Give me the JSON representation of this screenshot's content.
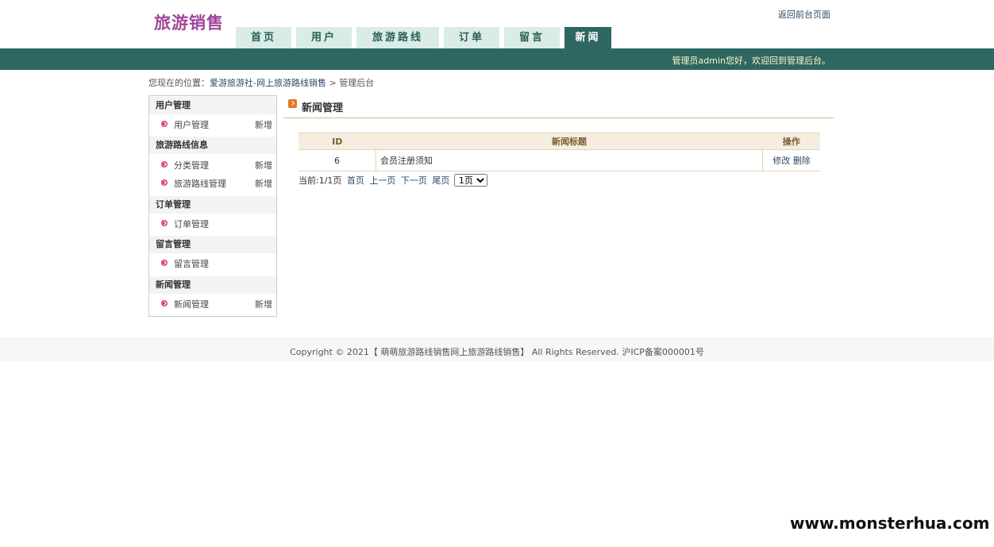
{
  "header": {
    "logo": "旅游销售",
    "back_link": "返回前台页面",
    "nav": [
      {
        "label": "首页",
        "active": false
      },
      {
        "label": "用户",
        "active": false
      },
      {
        "label": "旅游路线",
        "active": false
      },
      {
        "label": "订单",
        "active": false
      },
      {
        "label": "留言",
        "active": false
      },
      {
        "label": "新闻",
        "active": true
      }
    ],
    "welcome": "管理员admin您好，欢迎回到管理后台。"
  },
  "breadcrumb": {
    "prefix": "您现在的位置：",
    "site": "爱游旅游社-网上旅游路线销售",
    "sep": " > ",
    "current": "管理后台"
  },
  "sidebar": {
    "sections": [
      {
        "title": "用户管理",
        "items": [
          {
            "label": "用户管理",
            "add": "新增"
          }
        ]
      },
      {
        "title": "旅游路线信息",
        "items": [
          {
            "label": "分类管理",
            "add": "新增"
          },
          {
            "label": "旅游路线管理",
            "add": "新增"
          }
        ]
      },
      {
        "title": "订单管理",
        "items": [
          {
            "label": "订单管理",
            "add": ""
          }
        ]
      },
      {
        "title": "留言管理",
        "items": [
          {
            "label": "留言管理",
            "add": ""
          }
        ]
      },
      {
        "title": "新闻管理",
        "items": [
          {
            "label": "新闻管理",
            "add": "新增"
          }
        ]
      }
    ]
  },
  "main": {
    "title": "新闻管理",
    "table": {
      "headers": [
        "ID",
        "新闻标题",
        "操作"
      ],
      "rows": [
        {
          "id": "6",
          "title": "会员注册须知",
          "edit": "修改",
          "delete": "删除"
        }
      ]
    },
    "pager": {
      "info": "当前:1/1页",
      "first": "首页",
      "prev": "上一页",
      "next": "下一页",
      "last": "尾页",
      "select_value": "1页"
    }
  },
  "footer": {
    "copyright": "Copyright © 2021【 萌萌旅游路线销售网上旅游路线销售】 All Rights Reserved. 沪ICP备案000001号"
  },
  "watermark": "www.monsterhua.com",
  "colors": {
    "nav_active": "#2e6762",
    "nav_tab": "#d9ece6",
    "logo": "#a0469a",
    "bullet": "#e0457a"
  }
}
